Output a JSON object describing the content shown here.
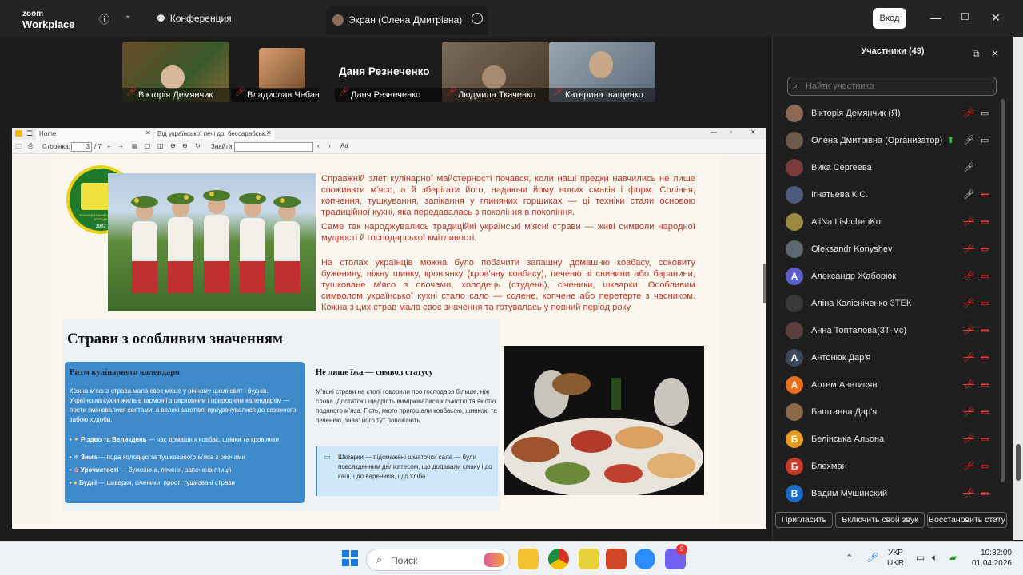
{
  "titlebar": {
    "logo_line1": "zoom",
    "logo_line2": "Workplace",
    "tab_conference": "Конференция",
    "tab_screen": "Экран (Олена Дмитрівна)",
    "login": "Вход"
  },
  "video_strip": [
    {
      "name": "Вікторія Демянчик"
    },
    {
      "name": "Владислав Чебану"
    },
    {
      "name": "Даня Резнеченко",
      "big": "Даня Резнеченко"
    },
    {
      "name": "Людмила Ткаченко"
    },
    {
      "name": "Катерина Іващенко"
    }
  ],
  "pdf": {
    "tab_home": "Home",
    "tab_doc": "Від української печі до: бессарабськ...",
    "page_label": "Сторінка:",
    "page_value": "3",
    "page_total": "/ 7",
    "find_label": "Знайти:",
    "logo_text": "ТЕХНОЛОГІЧНИЙ ФАХОВИЙ КОЛЕДЖ",
    "logo_year": "1902",
    "para1": "Справжній злет кулінарної майстерності почався, коли наші предки навчились не лише споживати м'ясо, а й зберігати його, надаючи йому нових смаків і форм. Соління, копчення, тушкування, запікання у глиняних горщиках — ці техніки стали основою традиційної кухні, яка передавалась з покоління в покоління.",
    "para2": "Саме так народжувались традиційні українські м'ясні страви — живі символи народної мудрості й господарської кмітливості.",
    "para3": "На столах українців можна було побачити запашну домашню ковбасу, соковиту буженину, ніжну шинку, кров'янку (кров'яну ковбасу), печеню зі свинини або баранини, тушковане м'ясо з овочами, холодець (студень), січеники, шкварки. Особливим символом української кухні стало сало — солене, копчене або перетерте з часником. Кожна з цих страв мала своє значення та готувалась у певний період року.",
    "heading": "Страви з особливим значенням",
    "box1_title": "Ритм кулінарного календаря",
    "box1_text": "Кожна м'ясна страва мала своє місце у річному циклі свят і буднів. Українська кухня жила в гармонії з церковним і природним календарем — пости змінювалися святами, а великі заготівлі приурочувалися до сезонного забою худоби.",
    "bullets": [
      {
        "bold": "Різдво та Великдень",
        "text": " — час домашніх ковбас, шинки та кров'янки"
      },
      {
        "bold": "Зима",
        "text": " — пора холодцю та тушкованого м'яса з овочами"
      },
      {
        "bold": "Урочистості",
        "text": " — буженина, печеня, запечена птиця"
      },
      {
        "bold": "Будні",
        "text": " — шкварки, січеники, прості тушковані страви"
      }
    ],
    "box2_title": "Не лише їжа — символ статусу",
    "box2_text": "М'ясні страви на столі говорили про господаря більше, ніж слова. Достаток і щедрість вимірювалися кількістю та якістю поданого м'яса. Гість, якого пригощали ковбасою, шинкою та печенею, знав: його тут поважають.",
    "box3_text": "Шкварки — підсмажені шматочки сала — були повсякденним делікатесом, що додавали смаку і до каш, і до вареників, і до хліба."
  },
  "panel": {
    "title": "Участники (49)",
    "search_placeholder": "Найти участника",
    "participants": [
      {
        "name": "Вікторія Демянчик (Я)",
        "av": "",
        "color": "#8a6a55"
      },
      {
        "name": "Олена Дмитрівна (Организатор)",
        "av": "",
        "color": "#6b5b4b"
      },
      {
        "name": "Вика Сергеева",
        "av": "",
        "color": "#7a3b3b"
      },
      {
        "name": "Ігнатьева К.С.",
        "av": "",
        "color": "#4d5a7a"
      },
      {
        "name": "AliNa LishchenKo",
        "av": "",
        "color": "#9a8a40"
      },
      {
        "name": "Oleksandr Konyshev",
        "av": "",
        "color": "#5a6a70"
      },
      {
        "name": "Александр Жаборюк",
        "av": "A",
        "color": "#5b5fc7"
      },
      {
        "name": "Аліна Колісніченко 3ТЕК",
        "av": "",
        "color": "#3a3a3a"
      },
      {
        "name": "Анна Топталова(3Т-мс)",
        "av": "",
        "color": "#5a4040"
      },
      {
        "name": "Антонюк Дар'я",
        "av": "А",
        "color": "#3c4a5a"
      },
      {
        "name": "Артем Аветисян",
        "av": "А",
        "color": "#e8701a"
      },
      {
        "name": "Баштанна Дар'я",
        "av": "",
        "color": "#8a6a4a"
      },
      {
        "name": "Белінська Альона",
        "av": "Б",
        "color": "#e89a1a"
      },
      {
        "name": "Блехман",
        "av": "Б",
        "color": "#c73a2a"
      },
      {
        "name": "Вадим Мушинский",
        "av": "В",
        "color": "#1a6ac7"
      }
    ],
    "btn_invite": "Пригласить",
    "btn_unmute": "Включить свой звук",
    "btn_restore": "Восстановить стату"
  },
  "taskbar": {
    "search": "Поиск",
    "lang1": "УКР",
    "lang2": "UKR",
    "time": "10:32:00",
    "date": "01.04.2026",
    "viber_badge": "9"
  }
}
